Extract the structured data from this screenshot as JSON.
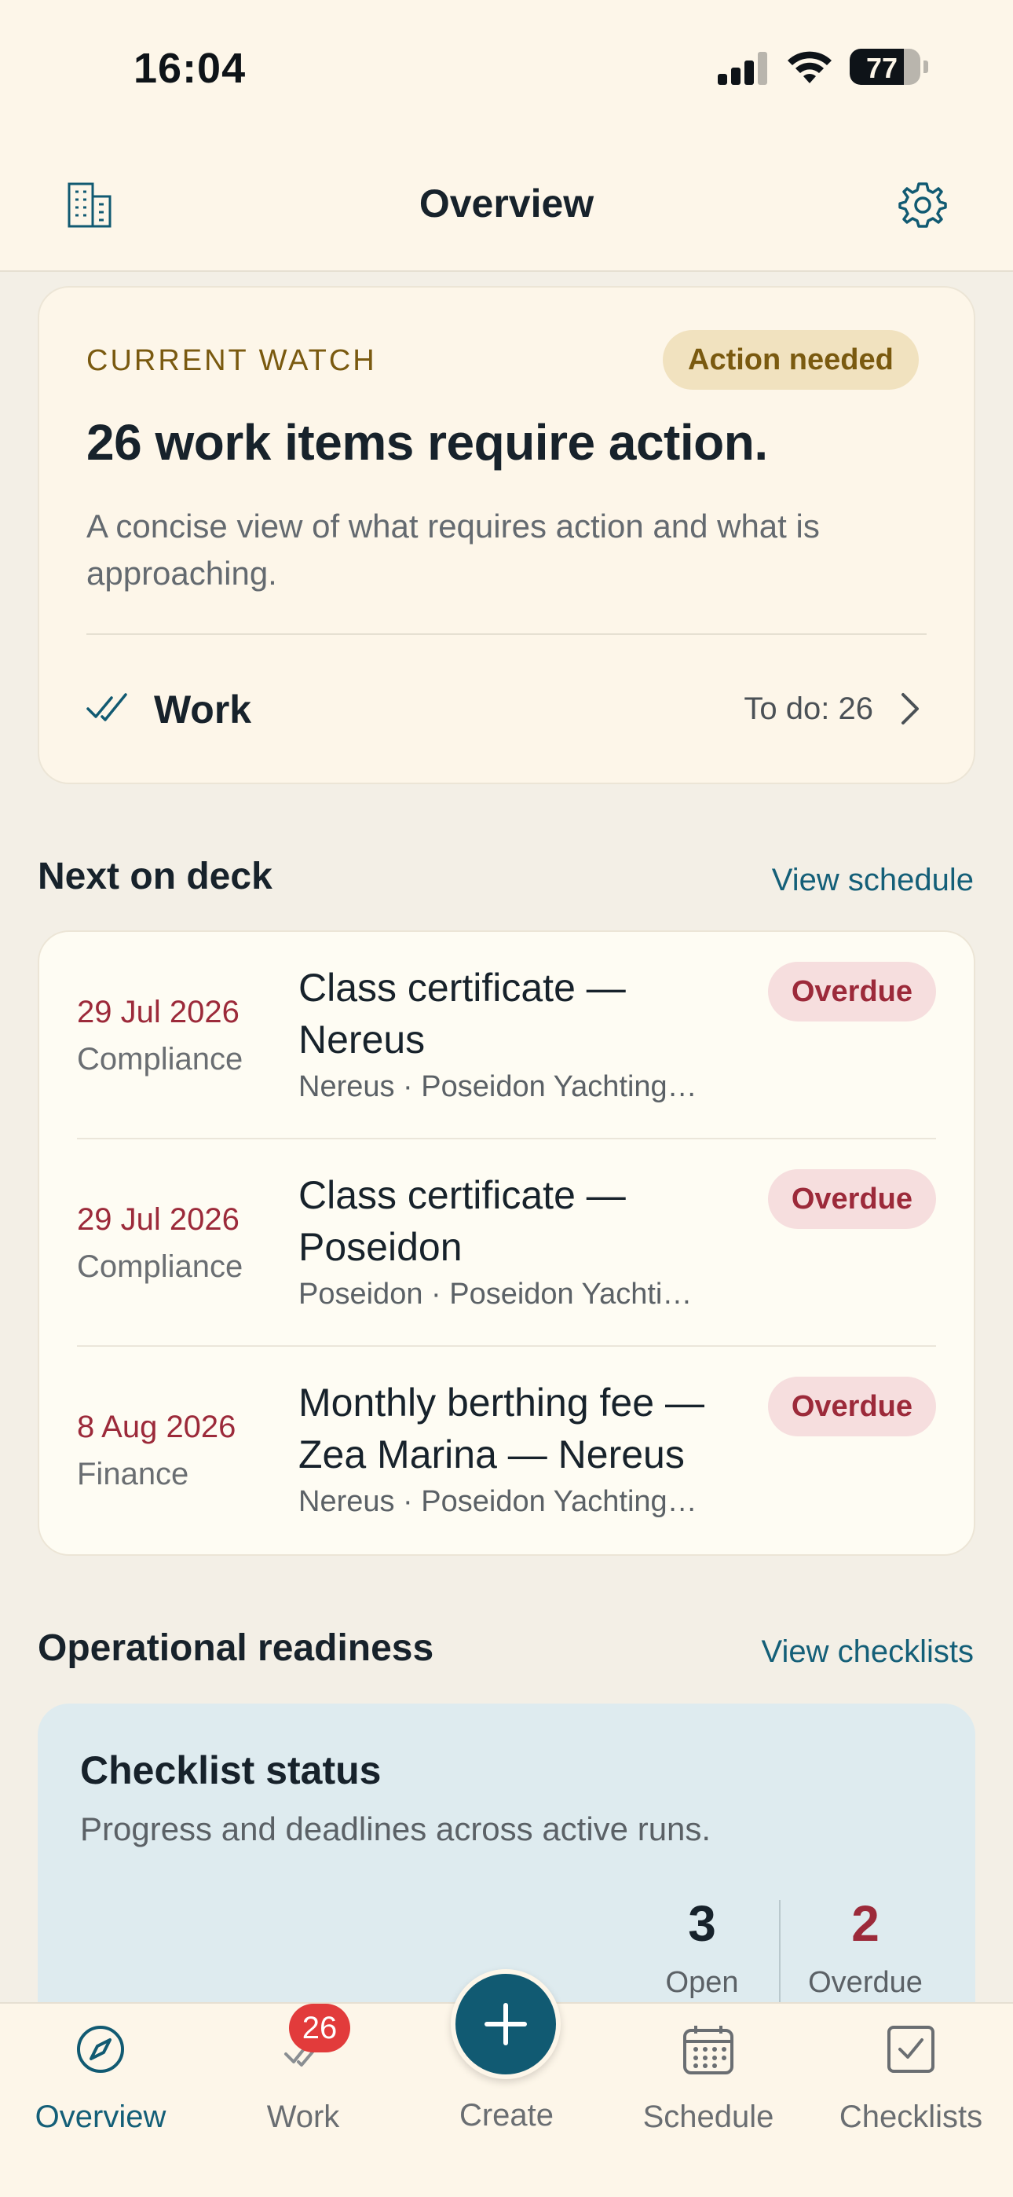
{
  "status_bar": {
    "time": "16:04",
    "battery": "77",
    "battery_level": 0.77
  },
  "nav": {
    "title": "Overview",
    "left_icon": "building-icon",
    "right_icon": "gear-icon"
  },
  "watch": {
    "eyebrow": "CURRENT WATCH",
    "badge": "Action needed",
    "headline": "26 work items require action.",
    "description": "A concise view of what requires action and what is approaching.",
    "work_label": "Work",
    "work_count": "To do: 26"
  },
  "deck": {
    "title": "Next on deck",
    "link": "View schedule",
    "items": [
      {
        "date": "29 Jul 2026",
        "category": "Compliance",
        "title": "Class certificate — Nereus",
        "subtitle": "Nereus · Poseidon Yachting…",
        "status": "Overdue"
      },
      {
        "date": "29 Jul 2026",
        "category": "Compliance",
        "title": "Class certificate — Poseidon",
        "subtitle": "Poseidon · Poseidon Yachti…",
        "status": "Overdue"
      },
      {
        "date": "8 Aug 2026",
        "category": "Finance",
        "title": "Monthly berthing fee — Zea Marina — Nereus",
        "subtitle": "Nereus · Poseidon Yachting…",
        "status": "Overdue"
      }
    ]
  },
  "readiness": {
    "title": "Operational readiness",
    "link": "View checklists",
    "card_title": "Checklist status",
    "card_desc": "Progress and deadlines across active runs.",
    "open_value": "3",
    "open_label": "Open",
    "overdue_value": "2",
    "overdue_label": "Overdue"
  },
  "tabs": {
    "overview": "Overview",
    "work": "Work",
    "work_badge": "26",
    "create": "Create",
    "schedule": "Schedule",
    "checklists": "Checklists"
  },
  "colors": {
    "accent": "#115a72",
    "warning": "#7a5a10",
    "danger": "#9c2a3a",
    "background": "#f3efe6"
  }
}
